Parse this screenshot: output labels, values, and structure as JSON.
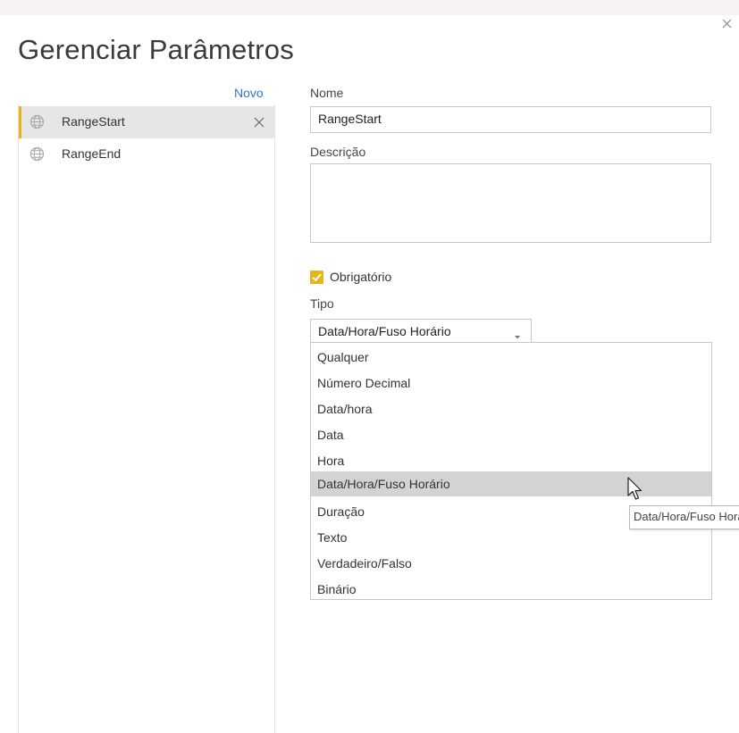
{
  "dialog": {
    "title": "Gerenciar Parâmetros",
    "close_icon": "close-icon"
  },
  "sidebar": {
    "new_link": "Novo",
    "items": [
      {
        "label": "RangeStart",
        "icon": "parameter-globe-icon",
        "selected": true
      },
      {
        "label": "RangeEnd",
        "icon": "parameter-globe-icon",
        "selected": false
      }
    ]
  },
  "form": {
    "name_label": "Nome",
    "name_value": "RangeStart",
    "description_label": "Descrição",
    "description_value": "",
    "required_label": "Obrigatório",
    "required_checked": true,
    "type_label": "Tipo",
    "type_value": "Data/Hora/Fuso Horário",
    "type_options": [
      "Qualquer",
      "Número Decimal",
      "Data/hora",
      "Data",
      "Hora",
      "Data/Hora/Fuso Horário",
      "Duração",
      "Texto",
      "Verdadeiro/Falso",
      "Binário"
    ],
    "hovered_option_index": 5,
    "tooltip": "Data/Hora/Fuso Horário"
  },
  "colors": {
    "accent": "#e8b519",
    "link": "#2b79c2",
    "selected_bg": "#e6e6e6",
    "hover_bg": "#d3d3d3"
  }
}
